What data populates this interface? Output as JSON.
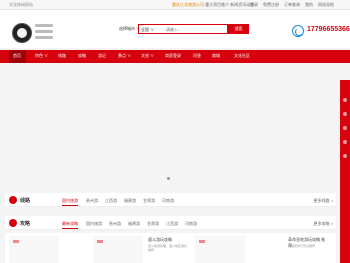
{
  "topbar": {
    "welcome": "文化休闲网站",
    "notice_hl": "重庆江北旅游公司",
    "notice": "重大项目推介  新闻资讯动态",
    "links": [
      "登录",
      "免费注册",
      "订单查询",
      "我的",
      "网站导航"
    ]
  },
  "header": {
    "search_label": "选择城市 ∨",
    "search_select": "全国 ∨",
    "search_placeholder": "请输入...",
    "search_button": "搜索",
    "phone": "17796655366"
  },
  "nav": {
    "items": [
      "首页",
      "特色 ∨",
      "线路",
      "攻略",
      "游记",
      "景点 ∨",
      "文创 ∨",
      "商家登录",
      "问答",
      "商城",
      "文化社区"
    ]
  },
  "sections": {
    "routes": {
      "title": "线路",
      "tabs": [
        "国内旅游",
        "贵州游",
        "江西游",
        "福建游",
        "甘肃游",
        "河南游"
      ],
      "more": "更多线路 >"
    },
    "guides": {
      "title": "攻略",
      "tabs": [
        "最新攻略",
        "国内旅游",
        "贵州游",
        "福建游",
        "甘肃游",
        "江西游",
        "河南游"
      ],
      "more": "更多攻略 >"
    }
  },
  "cards": [
    {
      "title": "遵义游玩攻略",
      "desc": "遵义旅游攻略，遵义地区游玩推荐"
    },
    {
      "title": "革命圣地游玩攻略 推荐",
      "desc": "行程安排与景点推荐"
    }
  ],
  "colors": {
    "brand_red": "#d6020d",
    "phone_blue": "#1a8de0"
  }
}
